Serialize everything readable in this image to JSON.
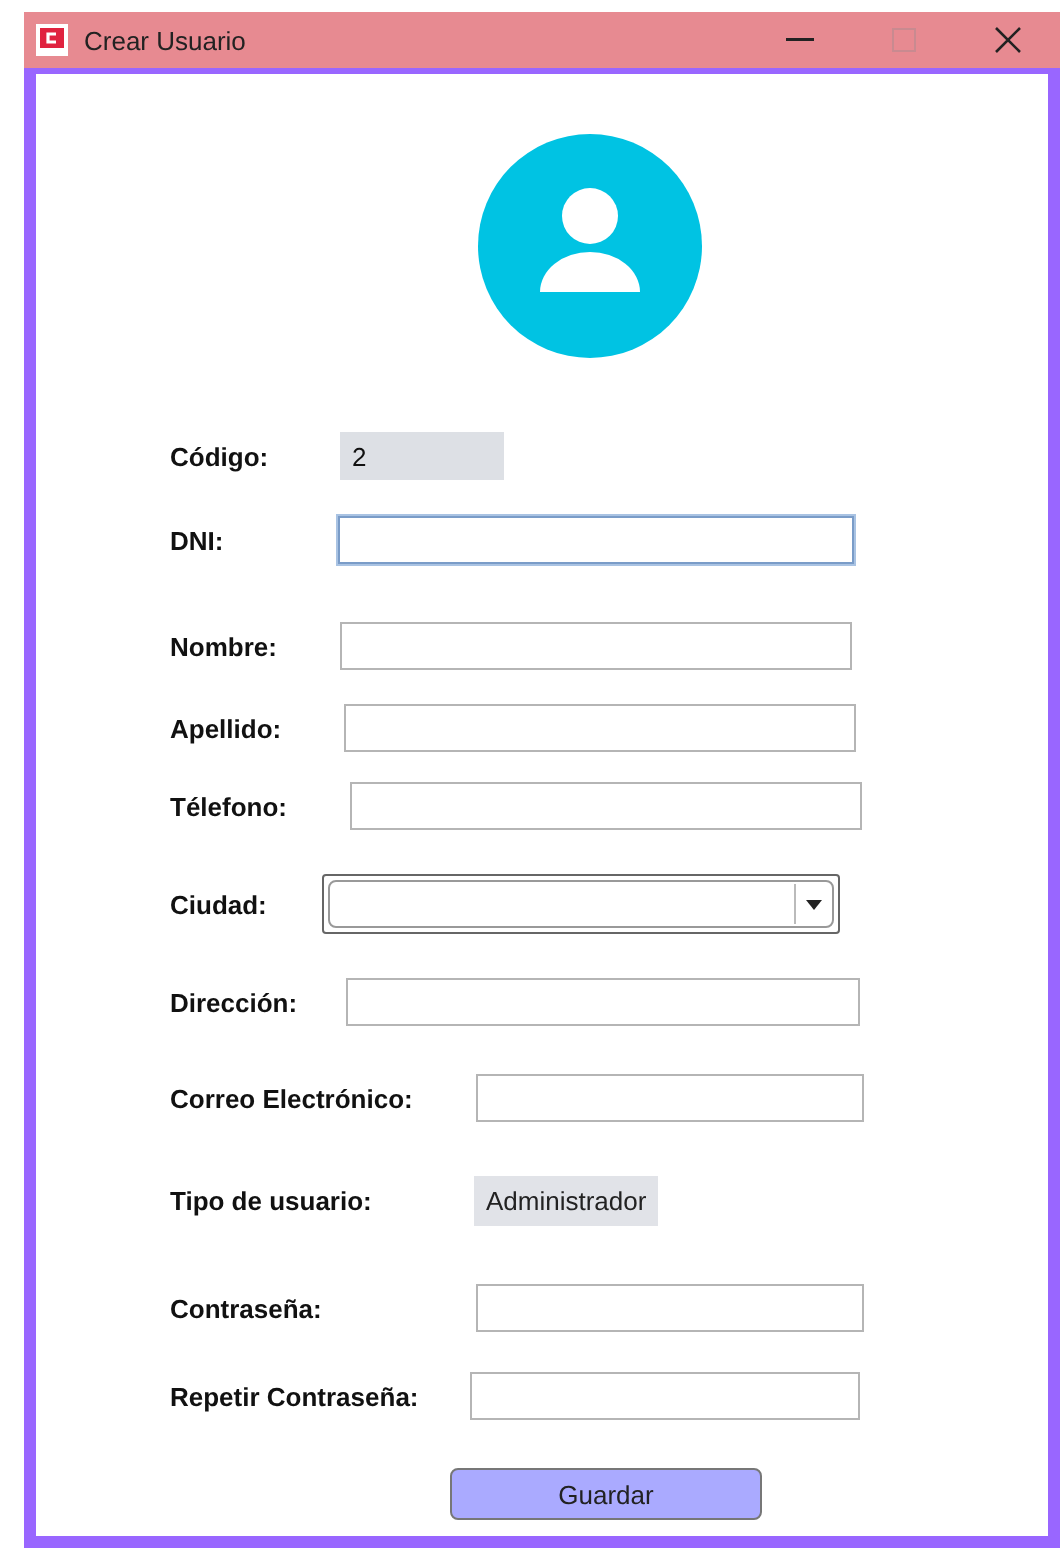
{
  "window": {
    "title": "Crear Usuario"
  },
  "fields": [
    {
      "label": "Código:",
      "kind": "readonly",
      "value": "2"
    },
    {
      "label": "DNI:",
      "kind": "text",
      "focused": true
    },
    {
      "label": "Nombre:",
      "kind": "text",
      "focused": false
    },
    {
      "label": "Apellido:",
      "kind": "text",
      "focused": false
    },
    {
      "label": "Télefono:",
      "kind": "text",
      "focused": false
    },
    {
      "label": "Ciudad:",
      "kind": "select"
    },
    {
      "label": "Dirección:",
      "kind": "text",
      "focused": false
    },
    {
      "label": "Correo Electrónico:",
      "kind": "text",
      "focused": false
    },
    {
      "label": "Tipo de usuario:",
      "kind": "static",
      "value": "Administrador"
    },
    {
      "label": "Contraseña:",
      "kind": "text",
      "focused": false
    },
    {
      "label": "Repetir Contraseña:",
      "kind": "text",
      "focused": false
    }
  ],
  "button": "Guardar"
}
